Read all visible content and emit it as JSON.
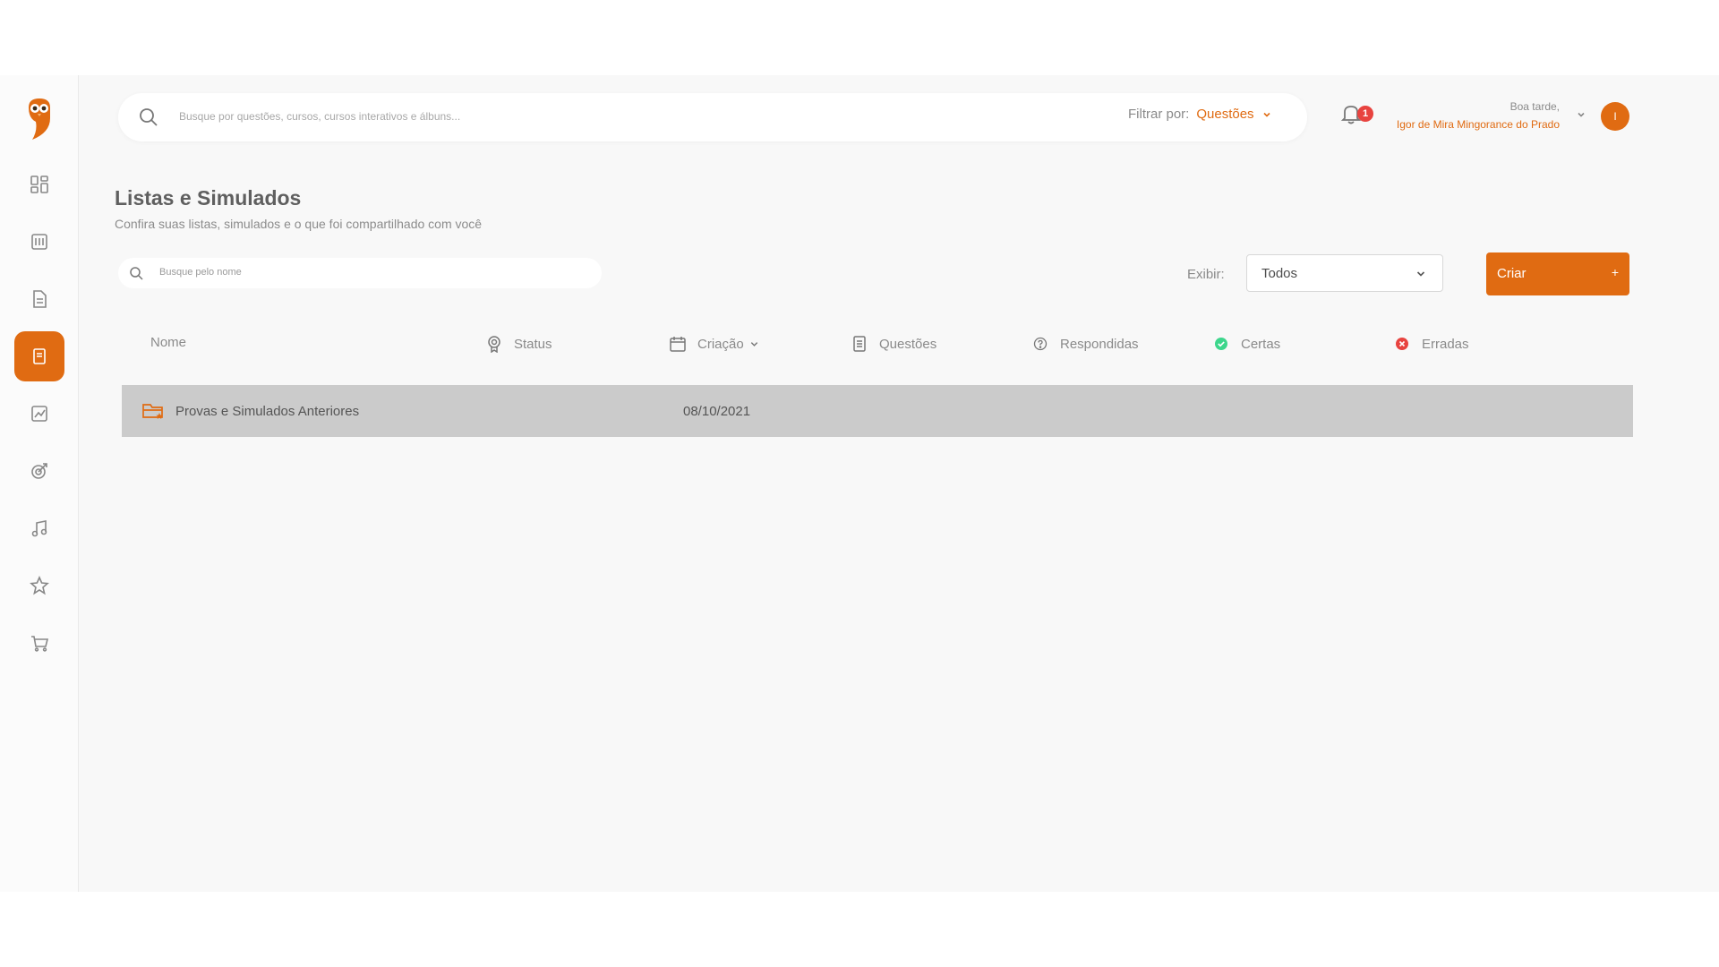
{
  "header": {
    "search_placeholder": "Busque por questões, cursos, cursos interativos e álbuns...",
    "filter_label": "Filtrar por:",
    "filter_value": "Questões",
    "notification_count": "1",
    "greeting": "Boa tarde,",
    "user_name": "Igor de Mira Mingorance do Prado",
    "avatar_initial": "I"
  },
  "page": {
    "title": "Listas e Simulados",
    "subtitle": "Confira suas listas, simulados e o que foi compartilhado com você"
  },
  "toolbar": {
    "name_search_placeholder": "Busque pelo nome",
    "exibir_label": "Exibir:",
    "exibir_value": "Todos",
    "create_label": "Criar",
    "create_plus": "+"
  },
  "table": {
    "columns": [
      "Nome",
      "Status",
      "Criação",
      "Questões",
      "Respondidas",
      "Certas",
      "Erradas"
    ],
    "rows": [
      {
        "name": "Provas e Simulados Anteriores",
        "created": "08/10/2021"
      }
    ]
  },
  "colors": {
    "accent": "#e06b12",
    "success": "#3dd68c",
    "danger": "#e8433f",
    "row_bg": "#cbcbcb"
  },
  "icons": {
    "sidebar": [
      "dashboard-icon",
      "book-icon",
      "document-icon",
      "lists-icon",
      "chart-icon",
      "target-icon",
      "music-icon",
      "star-icon",
      "cart-icon"
    ]
  }
}
